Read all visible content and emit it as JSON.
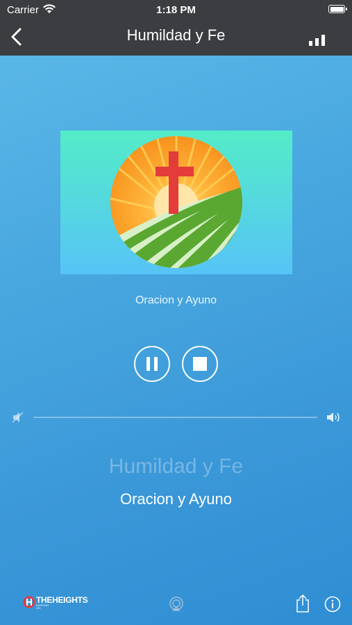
{
  "status_bar": {
    "carrier": "Carrier",
    "time": "1:18 PM"
  },
  "nav": {
    "title": "Humildad y Fe",
    "back_icon": "chevron-left-icon",
    "signal_icon": "signal-bars-icon"
  },
  "player": {
    "subtitle": "Oracion y Ayuno",
    "station_name": "Humildad y Fe",
    "now_playing": "Oracion y Ayuno",
    "volume_level": 0
  },
  "footer": {
    "brand": "THEHEIGHTS",
    "brand_sub": "HOSTING CO."
  },
  "colors": {
    "topbar": "#3b3d40",
    "accent_bg": "#4aa9e0",
    "cross": "#e43b3b",
    "sun": "#f7931e",
    "field": "#5aa832"
  }
}
